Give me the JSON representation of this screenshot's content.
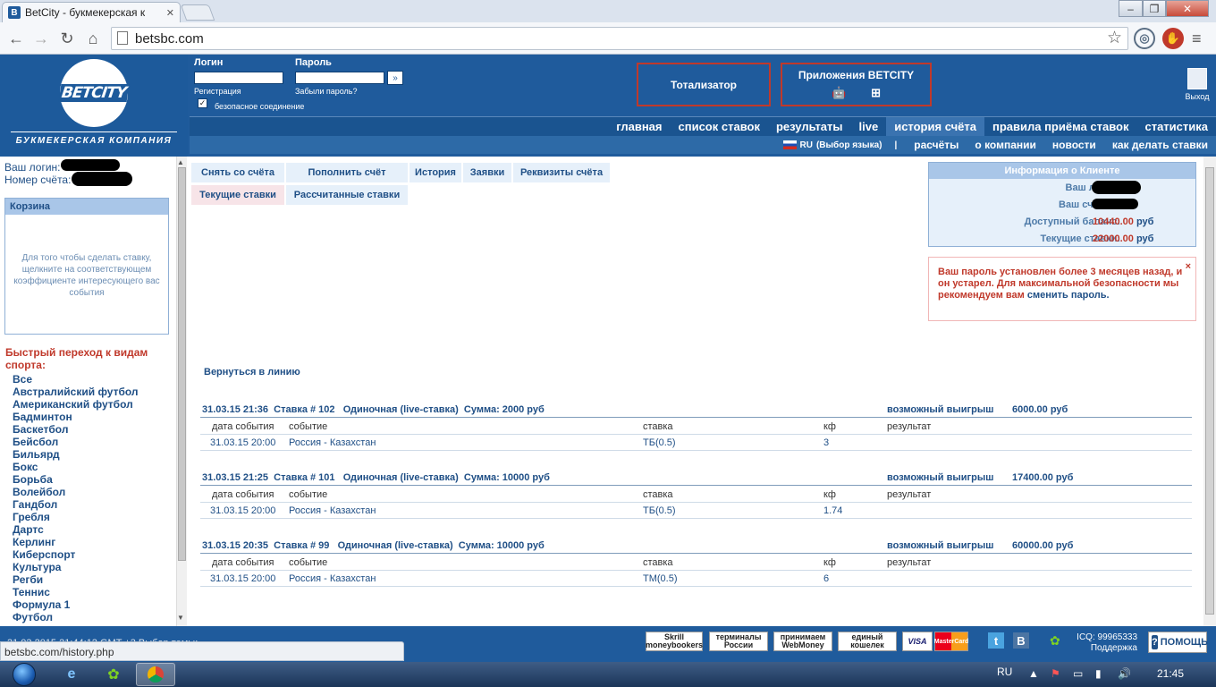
{
  "browser": {
    "tab_title": "BetCity - букмекерская к",
    "tab_favicon": "B",
    "url": "betsbc.com",
    "status_url": "betsbc.com/history.php"
  },
  "header": {
    "login_label": "Логин",
    "password_label": "Пароль",
    "register_link": "Регистрация",
    "forgot_link": "Забыли пароль?",
    "secure_label": "безопасное соединение",
    "logo_text": "BETCITY",
    "logo_tagline": "БУКМЕКЕРСКАЯ КОМПАНИЯ",
    "totalizator": "Тотализатор",
    "apps_title": "Приложения BETCITY",
    "exit_label": "Выход"
  },
  "nav_main": [
    "главная",
    "список ставок",
    "результаты",
    "live",
    "история счёта",
    "правила приёма ставок",
    "статистика"
  ],
  "nav_main_active": "история счёта",
  "nav_sub": {
    "lang": "RU",
    "lang_choose": "(Выбор языка)",
    "links": [
      "расчёты",
      "о компании",
      "новости",
      "как делать ставки"
    ]
  },
  "left": {
    "login_label": "Ваш логин:",
    "account_label": "Номер счёта:",
    "basket_title": "Корзина",
    "basket_hint": "Для того чтобы сделать ставку, щелкните на соответствующем коэффициенте интересующего вас события",
    "sports_title": "Быстрый переход к видам спорта:",
    "sports": [
      "Все",
      "Австралийский футбол",
      "Американский футбол",
      "Бадминтон",
      "Баскетбол",
      "Бейсбол",
      "Бильярд",
      "Бокс",
      "Борьба",
      "Волейбол",
      "Гандбол",
      "Гребля",
      "Дартс",
      "Керлинг",
      "Киберспорт",
      "Культура",
      "Регби",
      "Теннис",
      "Формула 1",
      "Футбол"
    ]
  },
  "tabs_row1": [
    "Снять со счёта",
    "Пополнить счёт",
    "История",
    "Заявки",
    "Реквизиты счёта"
  ],
  "tabs_row2": [
    "Текущие ставки",
    "Рассчитанные ставки"
  ],
  "back_link": "Вернуться в линию",
  "columns": {
    "date": "дата события",
    "event": "событие",
    "bet": "ставка",
    "coef": "кф",
    "result": "результат",
    "possible_win": "возможный выигрыш"
  },
  "bets": [
    {
      "header": "31.03.15 21:36  Ставка # 102   Одиночная (live-ставка)  Сумма: 2000 руб",
      "win": "6000.00 руб",
      "date": "31.03.15 20:00",
      "event": "Россия - Казахстан",
      "bet": "ТБ(0.5)",
      "coef": "3"
    },
    {
      "header": "31.03.15 21:25  Ставка # 101   Одиночная (live-ставка)  Сумма: 10000 руб",
      "win": "17400.00 руб",
      "date": "31.03.15 20:00",
      "event": "Россия - Казахстан",
      "bet": "ТБ(0.5)",
      "coef": "1.74"
    },
    {
      "header": "31.03.15 20:35  Ставка # 99   Одиночная (live-ставка)  Сумма: 10000 руб",
      "win": "60000.00 руб",
      "date": "31.03.15 20:00",
      "event": "Россия - Казахстан",
      "bet": "ТМ(0.5)",
      "coef": "6"
    }
  ],
  "client_info": {
    "title": "Информация о Клиенте",
    "login_label": "Ваш логин:",
    "account_label": "Ваш счёт №:",
    "balance_label": "Доступный баланс:",
    "balance_value": "10440.00",
    "current_label": "Текущие ставки:",
    "current_value": "22000.00",
    "currency": "руб"
  },
  "warning": {
    "text": "Ваш пароль установлен более 3 месяцев назад, и он устарел. Для максимальной безопасности мы рекомендуем вам",
    "link": "сменить пароль.",
    "close": "×"
  },
  "footer": {
    "left_text": "31.03.2015  21:44:12  GMT +3      Выбор темы:",
    "payments": [
      "Skrill moneybookers",
      "терминалы России",
      "принимаем WebMoney",
      "единый кошелек",
      "VISA",
      "MasterCard"
    ],
    "social": [
      "t",
      "B"
    ],
    "icq": "ICQ: 99965333",
    "support": "Поддержка",
    "help": "ПОМОЩЬ"
  },
  "taskbar": {
    "lang": "RU",
    "time": "21:45"
  },
  "colors": {
    "brand_blue": "#1f5b9c",
    "nav_active": "#3a73b0",
    "accent_red": "#c0392b",
    "link_blue": "#1f4f86"
  }
}
